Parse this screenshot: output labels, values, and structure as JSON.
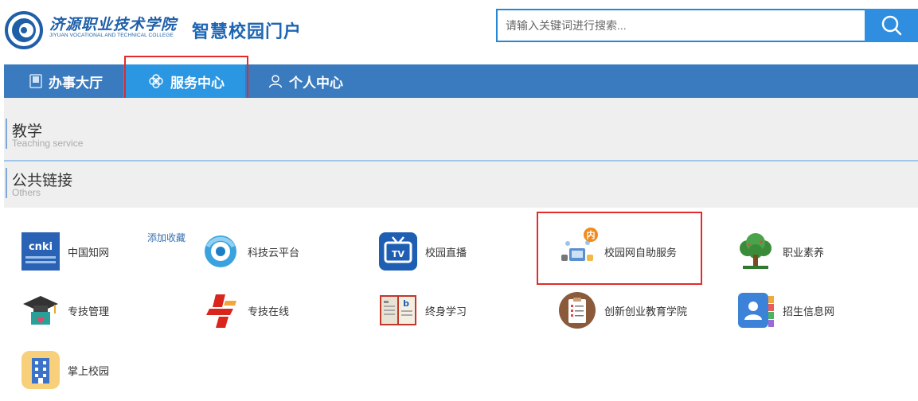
{
  "header": {
    "school_name_cn": "济源职业技术学院",
    "school_name_en": "JIYUAN VOCATIONAL AND TECHNICAL COLLEGE",
    "portal_title": "智慧校园门户",
    "search_placeholder": "请输入关键词进行搜索..."
  },
  "nav": {
    "items": [
      {
        "label": "办事大厅",
        "icon": "document-icon",
        "active": false
      },
      {
        "label": "服务中心",
        "icon": "clover-icon",
        "active": true
      },
      {
        "label": "个人中心",
        "icon": "user-icon",
        "active": false
      }
    ]
  },
  "sections": [
    {
      "title": "教学",
      "subtitle": "Teaching service"
    },
    {
      "title": "公共链接",
      "subtitle": "Others"
    }
  ],
  "links": {
    "collect_label": "添加收藏",
    "badge_label": "内",
    "items": [
      {
        "label": "中国知网",
        "icon": "cnki-icon"
      },
      {
        "label": "科技云平台",
        "icon": "cloud-platform-icon"
      },
      {
        "label": "校园直播",
        "icon": "tv-icon"
      },
      {
        "label": "校园网自助服务",
        "icon": "network-self-service-icon"
      },
      {
        "label": "职业素养",
        "icon": "tree-icon"
      },
      {
        "label": "专技管理",
        "icon": "graduation-cap-icon"
      },
      {
        "label": "专技在线",
        "icon": "red-logo-icon"
      },
      {
        "label": "终身学习",
        "icon": "book-icon"
      },
      {
        "label": "创新创业教育学院",
        "icon": "clipboard-icon"
      },
      {
        "label": "招生信息网",
        "icon": "contacts-icon"
      },
      {
        "label": "掌上校园",
        "icon": "building-icon"
      }
    ]
  },
  "colors": {
    "nav_bg": "#3a7bbf",
    "nav_active": "#2b97e3",
    "brand_blue": "#1d66b3",
    "highlight_red": "#e22b2b"
  }
}
